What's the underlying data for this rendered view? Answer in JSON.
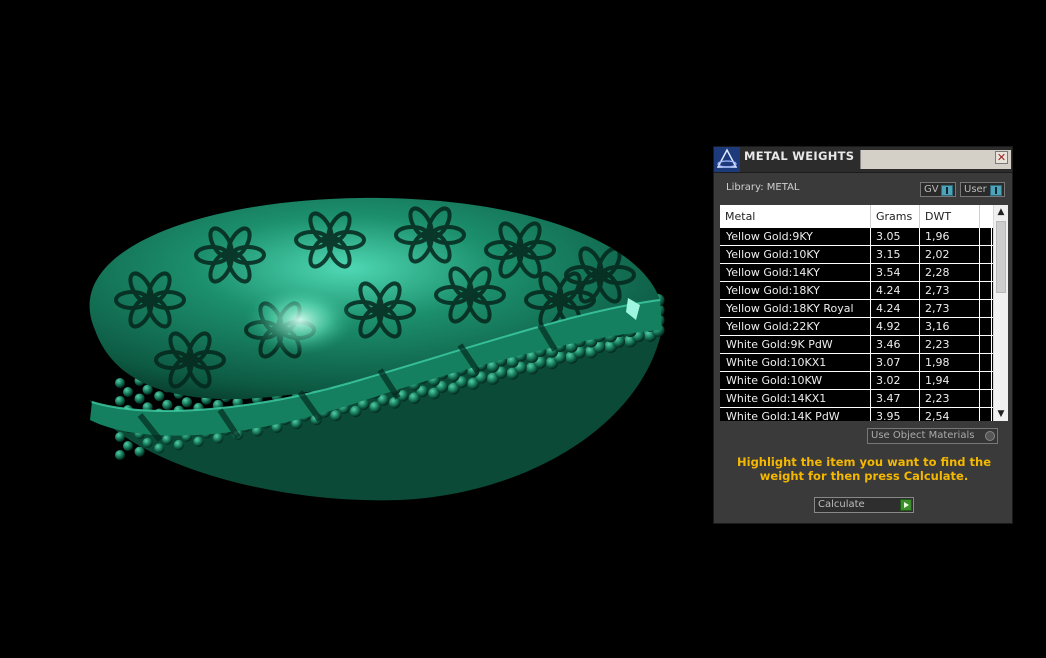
{
  "panel": {
    "title": "METAL WEIGHTS",
    "close_symbol": "✕",
    "library_label": "Library: METAL",
    "gv_label": "GV",
    "user_label": "User",
    "use_object_materials_label": "Use Object Materials",
    "instructions": "Highlight the item you want to find the weight for then press Calculate.",
    "calculate_label": "Calculate",
    "accent_color": "#f5b800"
  },
  "table": {
    "headers": {
      "metal": "Metal",
      "grams": "Grams",
      "dwt": "DWT"
    },
    "rows": [
      {
        "metal": "Yellow Gold:9KY",
        "grams": "3.05",
        "dwt": "1,96"
      },
      {
        "metal": "Yellow Gold:10KY",
        "grams": "3.15",
        "dwt": "2,02"
      },
      {
        "metal": "Yellow Gold:14KY",
        "grams": "3.54",
        "dwt": "2,28"
      },
      {
        "metal": "Yellow Gold:18KY",
        "grams": "4.24",
        "dwt": "2,73"
      },
      {
        "metal": "Yellow Gold:18KY Royal",
        "grams": "4.24",
        "dwt": "2,73"
      },
      {
        "metal": "Yellow Gold:22KY",
        "grams": "4.92",
        "dwt": "3,16"
      },
      {
        "metal": "White Gold:9K PdW",
        "grams": "3.46",
        "dwt": "2,23"
      },
      {
        "metal": "White Gold:10KX1",
        "grams": "3.07",
        "dwt": "1,98"
      },
      {
        "metal": "White Gold:10KW",
        "grams": "3.02",
        "dwt": "1,94"
      },
      {
        "metal": "White Gold:14KX1",
        "grams": "3.47",
        "dwt": "2,23"
      },
      {
        "metal": "White Gold:14K PdW",
        "grams": "3.95",
        "dwt": "2,54"
      }
    ]
  }
}
